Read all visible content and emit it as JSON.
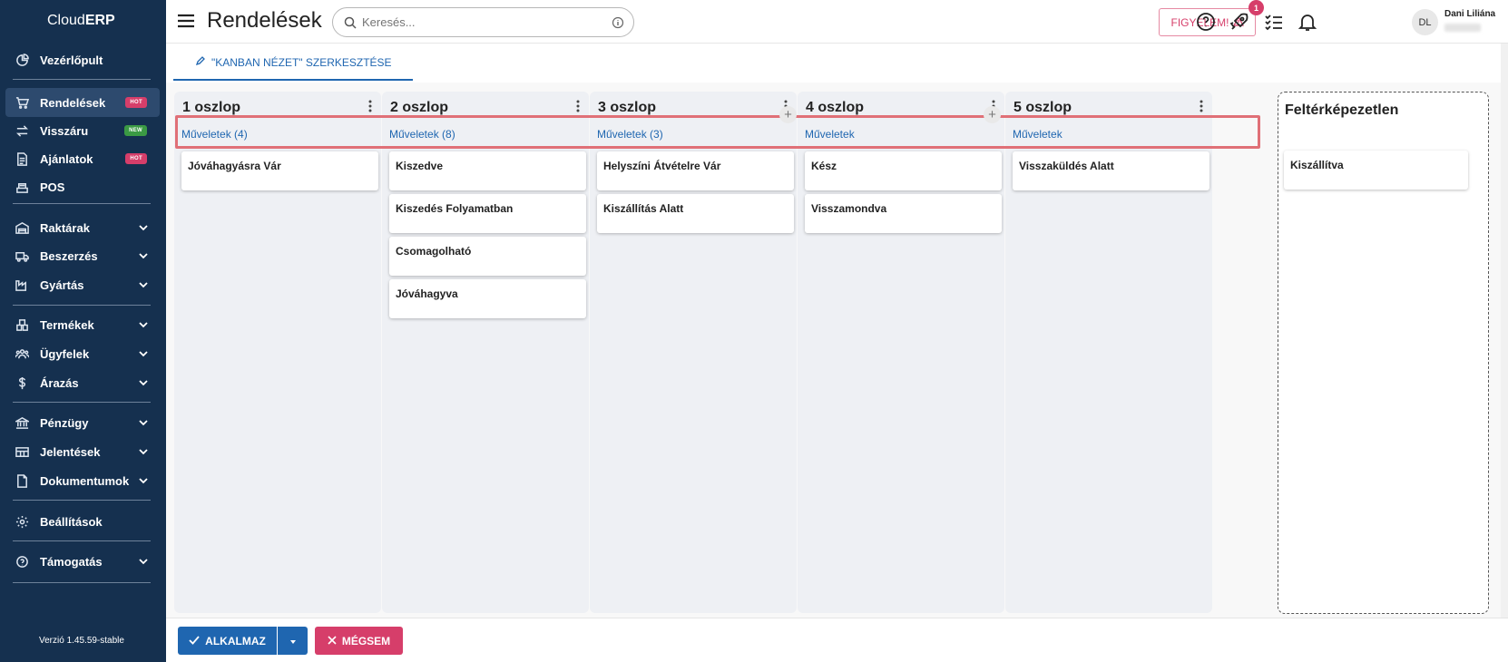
{
  "app": {
    "logo_plain": "Cloud",
    "logo_bold": "ERP",
    "version": "Verzió 1.45.59-stable"
  },
  "sidebar": {
    "items": [
      {
        "label": "Vezérlőpult",
        "icon": "dashboard-icon"
      },
      {
        "label": "Rendelések",
        "icon": "cart-icon",
        "badge": "HOT",
        "active": true
      },
      {
        "label": "Visszáru",
        "icon": "swap-icon",
        "badge": "NEW"
      },
      {
        "label": "Ajánlatok",
        "icon": "document-icon",
        "badge": "HOT"
      },
      {
        "label": "POS",
        "icon": "register-icon"
      },
      {
        "label": "Raktárak",
        "icon": "warehouse-icon"
      },
      {
        "label": "Beszerzés",
        "icon": "truck-icon"
      },
      {
        "label": "Gyártás",
        "icon": "factory-icon"
      },
      {
        "label": "Termékek",
        "icon": "products-icon"
      },
      {
        "label": "Ügyfelek",
        "icon": "customers-icon"
      },
      {
        "label": "Árazás",
        "icon": "dollar-icon"
      },
      {
        "label": "Pénzügy",
        "icon": "bank-icon"
      },
      {
        "label": "Jelentések",
        "icon": "table-icon"
      },
      {
        "label": "Dokumentumok",
        "icon": "file-icon"
      },
      {
        "label": "Beállítások",
        "icon": "gear-icon"
      },
      {
        "label": "Támogatás",
        "icon": "help-icon"
      }
    ]
  },
  "header": {
    "title": "Rendelések",
    "search_placeholder": "Keresés...",
    "alert_label": "FIGYELEM!",
    "notification_count": "1",
    "user_initials": "DL",
    "user_name": "Dani Liliána"
  },
  "tabs": [
    {
      "label": "\"KANBAN NÉZET\" SZERKESZTÉSE"
    }
  ],
  "columns": [
    {
      "name": "1 oszlop",
      "ops": "Műveletek (4)",
      "cards": [
        "Jóváhagyásra Vár"
      ]
    },
    {
      "name": "2 oszlop",
      "ops": "Műveletek (8)",
      "cards": [
        "Kiszedve",
        "Kiszedés Folyamatban",
        "Csomagolható",
        "Jóváhagyva"
      ]
    },
    {
      "name": "3 oszlop",
      "ops": "Műveletek (3)",
      "cards": [
        "Helyszíni Átvételre Vár",
        "Kiszállítás Alatt"
      ]
    },
    {
      "name": "4 oszlop",
      "ops": "Műveletek",
      "cards": [
        "Kész",
        "Visszamondva"
      ]
    },
    {
      "name": "5 oszlop",
      "ops": "Műveletek",
      "cards": [
        "Visszaküldés Alatt"
      ]
    }
  ],
  "unmapped": {
    "title": "Feltérképezetlen",
    "cards": [
      "Kiszállítva"
    ]
  },
  "footer": {
    "apply_label": "ALKALMAZ",
    "cancel_label": "MÉGSEM"
  },
  "colors": {
    "sidebar": "#15304f",
    "accent": "#1f66b0",
    "danger": "#d63e6a",
    "highlight": "#e07077"
  }
}
